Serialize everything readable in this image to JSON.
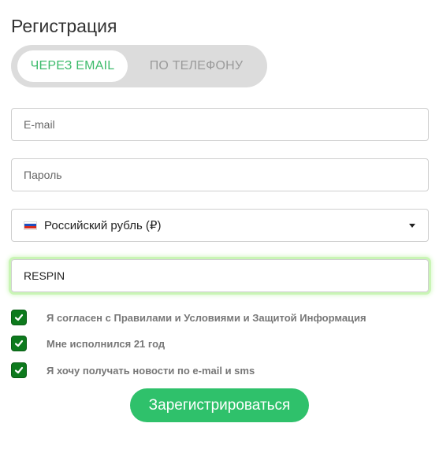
{
  "title": "Регистрация",
  "tabs": {
    "email_label": "ЧЕРЕЗ EMAIL",
    "phone_label": "ПО ТЕЛЕФОНУ"
  },
  "fields": {
    "email_placeholder": "E-mail",
    "password_placeholder": "Пароль"
  },
  "currency": {
    "selected": "Российский рубль (₽)",
    "flag_icon": "russia-flag-icon"
  },
  "promo": {
    "value": "RESPIN"
  },
  "checkboxes": [
    {
      "label": "Я согласен с Правилами и Условиями и Защитой Информация",
      "checked": true
    },
    {
      "label": "Мне исполнился 21 год",
      "checked": true
    },
    {
      "label": "Я хочу получать новости по e-mail и sms",
      "checked": true
    }
  ],
  "submit_label": "Зарегистрироваться",
  "colors": {
    "accent": "#2fc16b",
    "tab_active_text": "#3dbb6b",
    "checkbox": "#0d7a1d",
    "promo_glow": "#c9f5b5"
  }
}
